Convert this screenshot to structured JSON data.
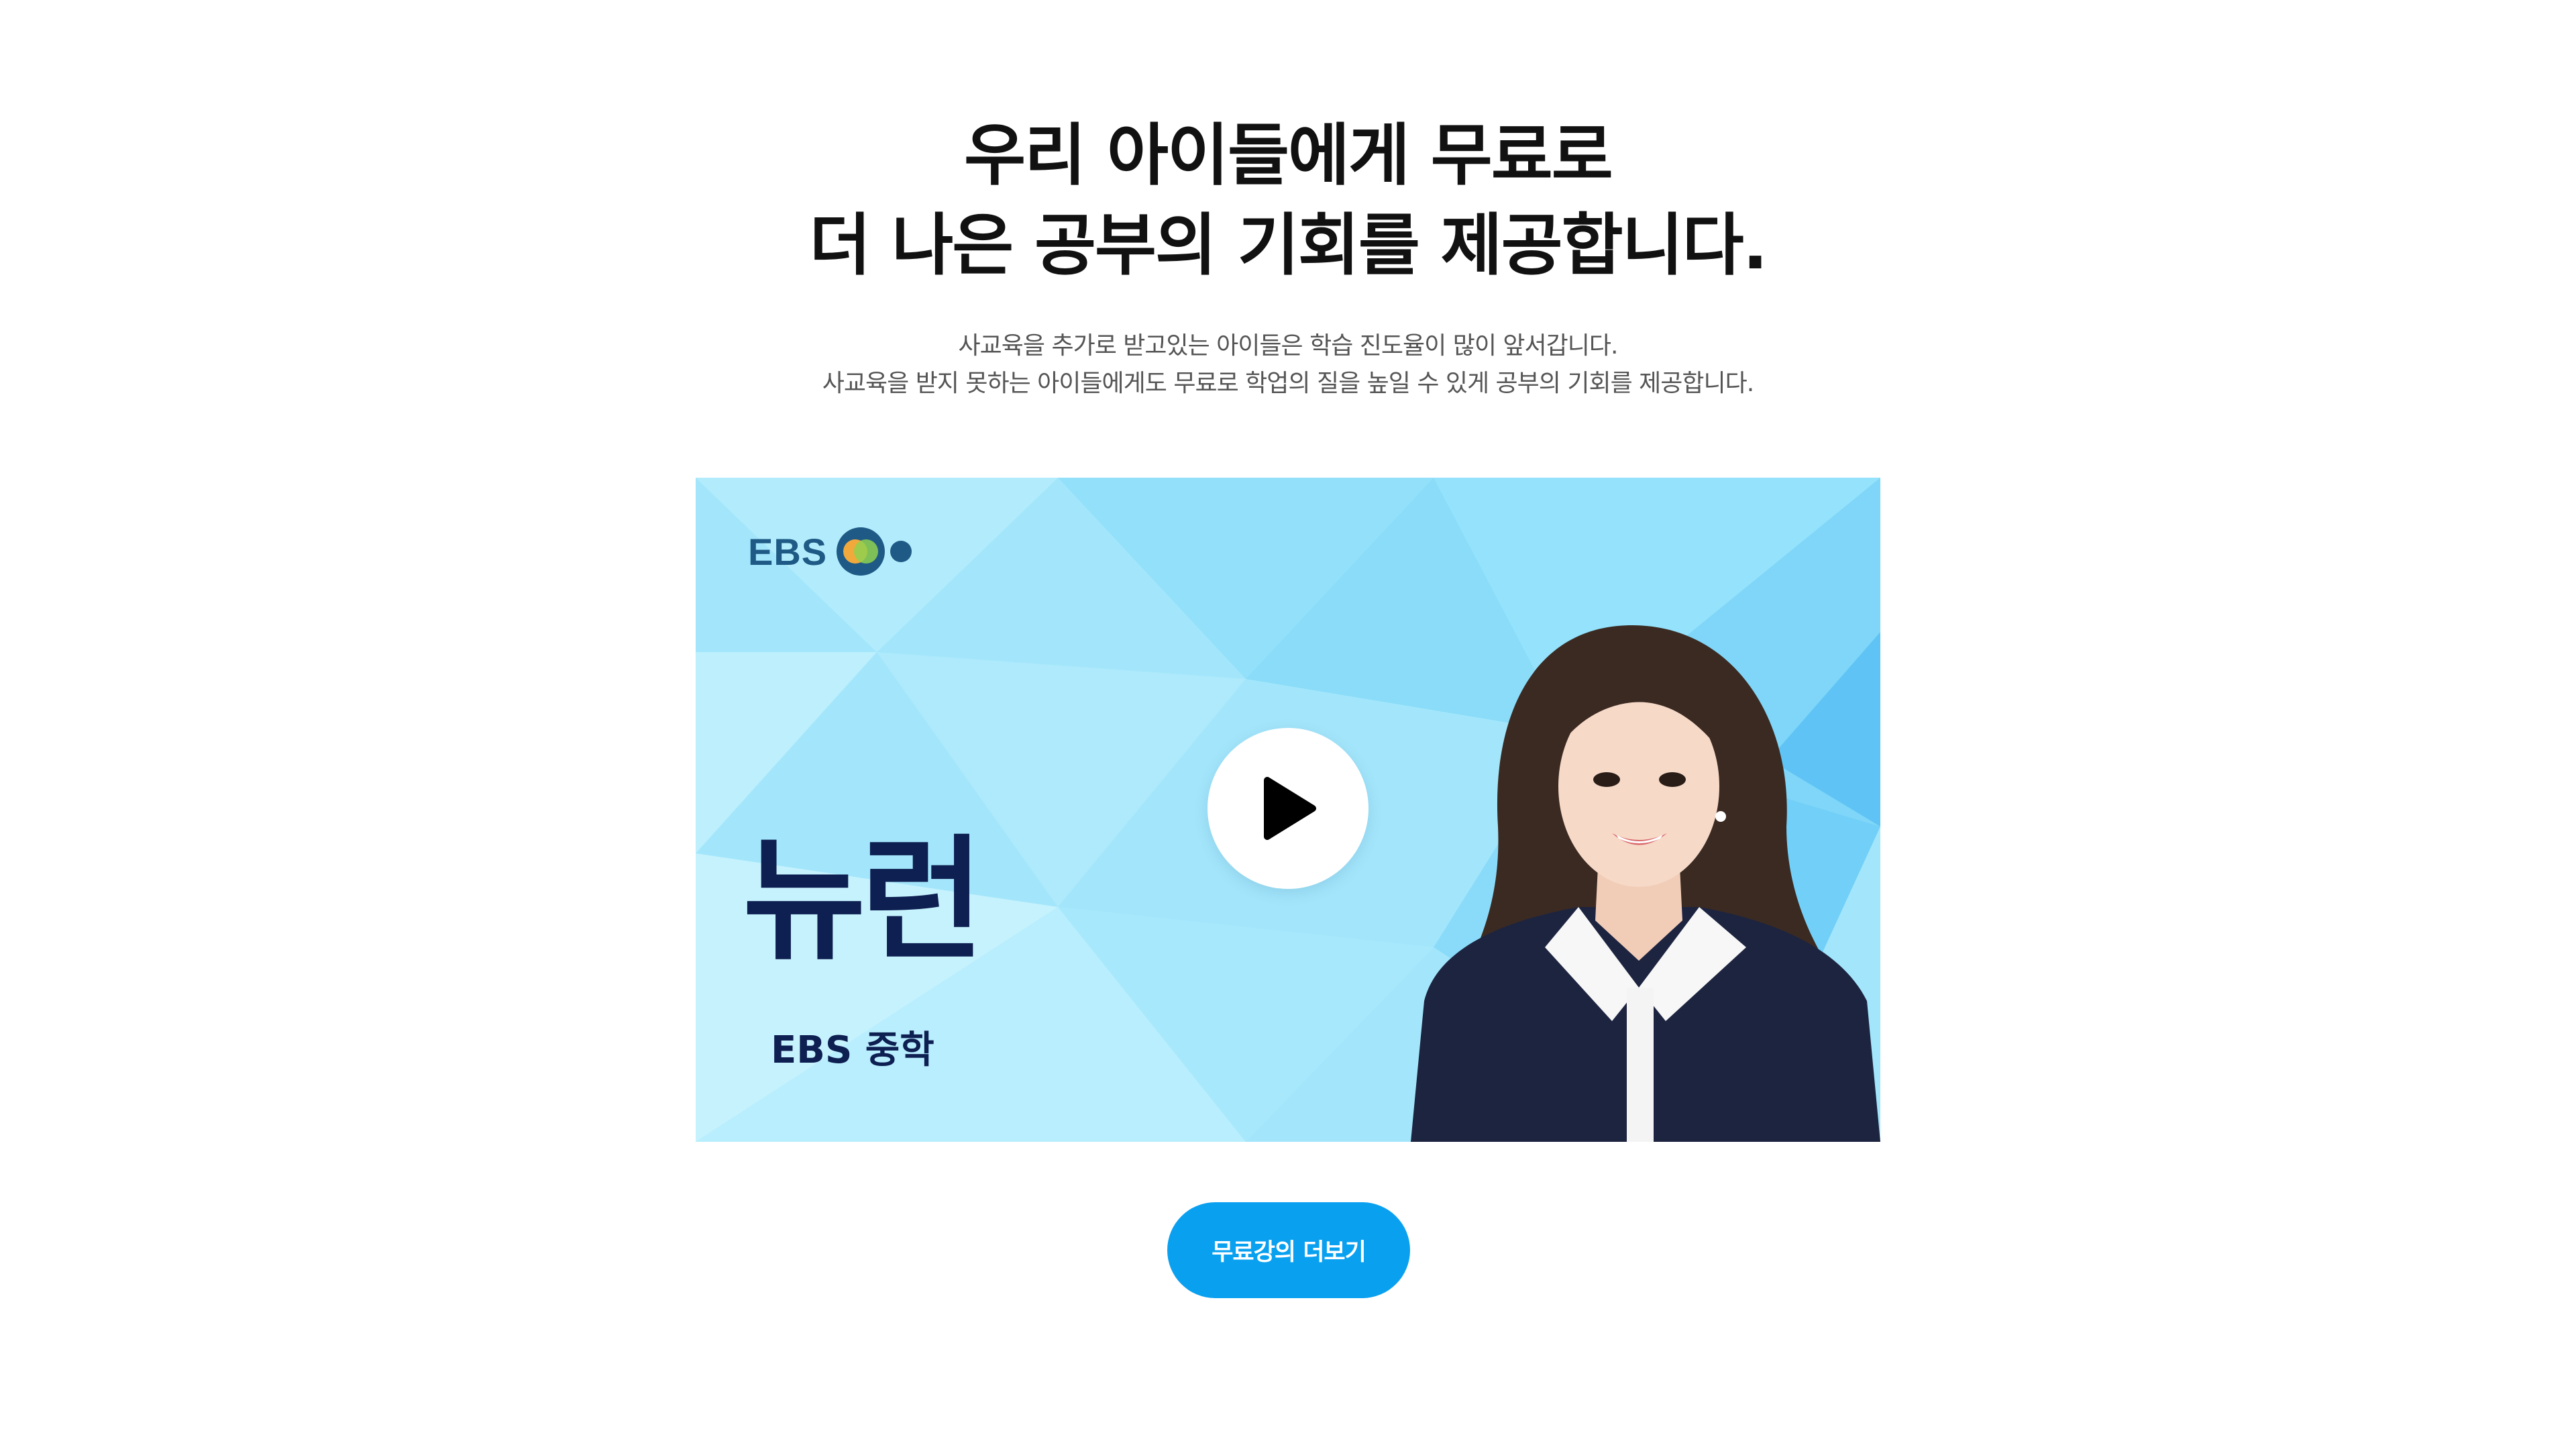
{
  "headline": {
    "line1": "우리 아이들에게 무료로",
    "line2": "더 나은 공부의 기회를 제공합니다."
  },
  "subcopy": {
    "line1": "사교육을 추가로 받고있는 아이들은 학습 진도율이 많이 앞서갑니다.",
    "line2": "사교육을 받지 못하는 아이들에게도 무료로 학업의 질을 높일 수 있게 공부의 기회를 제공합니다."
  },
  "video": {
    "logo_text": "EBS",
    "course_title": "뉴런",
    "course_subtitle": "EBS 중학",
    "play_icon": "play-icon",
    "background_color": "#9fe5fb"
  },
  "more_button": {
    "label": "무료강의 더보기",
    "color": "#0aa0f0"
  }
}
